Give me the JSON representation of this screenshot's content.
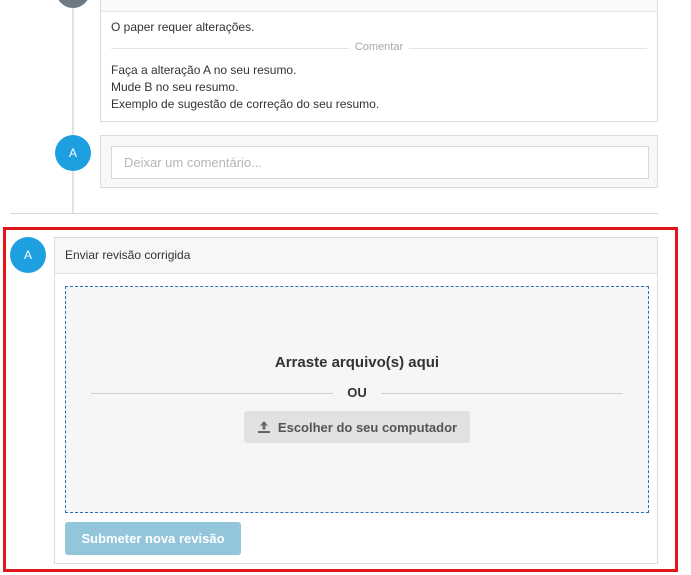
{
  "review": {
    "text": "O paper requer alterações.",
    "divider_label": "Comentar",
    "comment_lines": [
      "Faça a alteração A no seu resumo.",
      "Mude B no seu resumo.",
      "Exemplo de sugestão de correção do seu resumo."
    ]
  },
  "comment": {
    "avatar_initial": "A",
    "placeholder": "Deixar um comentário..."
  },
  "upload": {
    "avatar_initial": "A",
    "header_title": "Enviar revisão corrigida",
    "drop_title": "Arraste arquivo(s) aqui",
    "or_label": "OU",
    "choose_label": "Escolher do seu computador",
    "submit_label": "Submeter nova revisão"
  },
  "colors": {
    "avatar": "#1ea0e0",
    "highlight_frame": "#e0161b",
    "submit_disabled": "#93c6da",
    "dropzone_border": "#2a6fb5"
  },
  "icons": {
    "upload": "upload-icon"
  }
}
